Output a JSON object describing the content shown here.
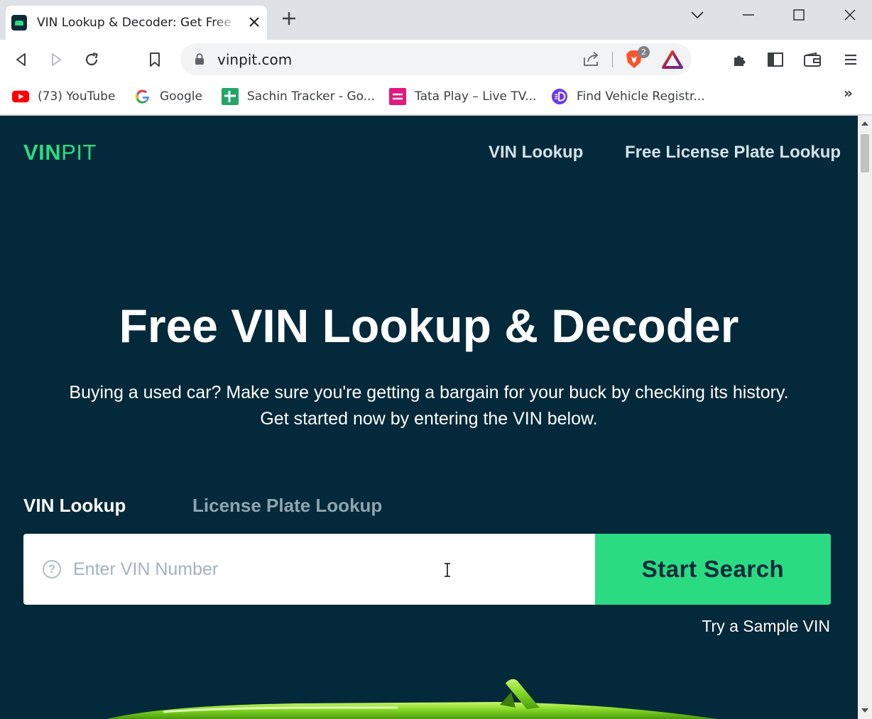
{
  "browser": {
    "tab": {
      "title": "VIN Lookup & Decoder: Get Free VIN",
      "close_icon": "close-icon"
    },
    "new_tab_icon": "plus-icon",
    "window_controls": [
      "chevron-down-icon",
      "minimize-icon",
      "maximize-icon",
      "close-icon"
    ],
    "toolbar": {
      "url": "vinpit.com",
      "brave_badge_count": "2",
      "icons": [
        "back-icon",
        "forward-icon",
        "reload-icon",
        "bookmark-icon",
        "lock-icon",
        "share-icon",
        "brave-shield-icon",
        "brave-rewards-icon",
        "extensions-icon",
        "sidebar-icon",
        "wallet-icon",
        "menu-icon"
      ]
    },
    "bookmarks": [
      {
        "label": "(73) YouTube",
        "icon": "youtube-icon"
      },
      {
        "label": "Google",
        "icon": "google-icon"
      },
      {
        "label": "Sachin Tracker - Go...",
        "icon": "sheets-icon"
      },
      {
        "label": "Tata Play – Live TV...",
        "icon": "tata-play-icon"
      },
      {
        "label": "Find Vehicle Registr...",
        "icon": "vehicle-registry-icon"
      }
    ],
    "bookmarks_more": "»"
  },
  "site": {
    "logo_part1": "VIN",
    "logo_part2": "PIT",
    "nav": [
      "VIN Lookup",
      "Free License Plate Lookup"
    ],
    "hero": {
      "title": "Free VIN Lookup & Decoder",
      "subtitle_line1": "Buying a used car? Make sure you're getting a bargain for your buck by checking its history.",
      "subtitle_line2": "Get started now by entering the VIN below."
    },
    "search_tabs": [
      "VIN Lookup",
      "License Plate Lookup"
    ],
    "search": {
      "help_icon_text": "?",
      "placeholder": "Enter VIN Number",
      "value": "",
      "button": "Start Search"
    },
    "sample_link": "Try a Sample VIN"
  },
  "colors": {
    "page_bg": "#03293A",
    "accent": "#2ADB82",
    "inactive_tab": "#8FA4B0"
  }
}
